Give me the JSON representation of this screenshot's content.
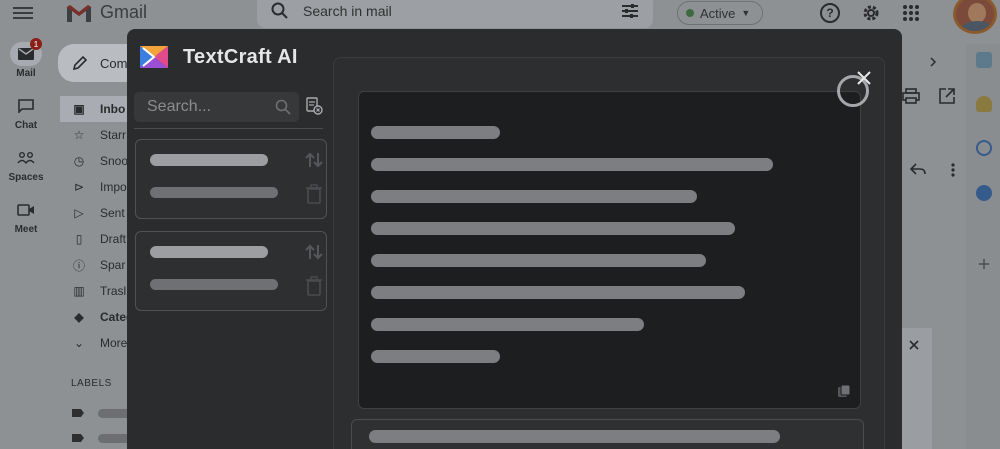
{
  "gmail": {
    "app_name": "Gmail",
    "search_placeholder": "Search in mail",
    "status_label": "Active",
    "rail": [
      {
        "label": "Mail",
        "badge": "1"
      },
      {
        "label": "Chat"
      },
      {
        "label": "Spaces"
      },
      {
        "label": "Meet"
      }
    ],
    "compose_label": "Com",
    "folders": [
      "Inbo",
      "Starr",
      "Snoo",
      "Impo",
      "Sent",
      "Draft",
      "Spar",
      "Trasl",
      "Categ",
      "More"
    ],
    "labels_heading": "LABELS"
  },
  "textcraft": {
    "brand_name": "TextCraft AI",
    "search_placeholder": "Search...",
    "history_items": [
      {
        "loading": true
      },
      {
        "loading": true
      }
    ],
    "output_lines": [
      0.27,
      0.84,
      0.68,
      0.76,
      0.7,
      0.78,
      0.57,
      0.27
    ],
    "input_line": 0.84,
    "colors": {
      "modal_bg": "#2a2c2e",
      "output_bg": "#1c1e20",
      "skeleton": "#7c7e81"
    }
  }
}
